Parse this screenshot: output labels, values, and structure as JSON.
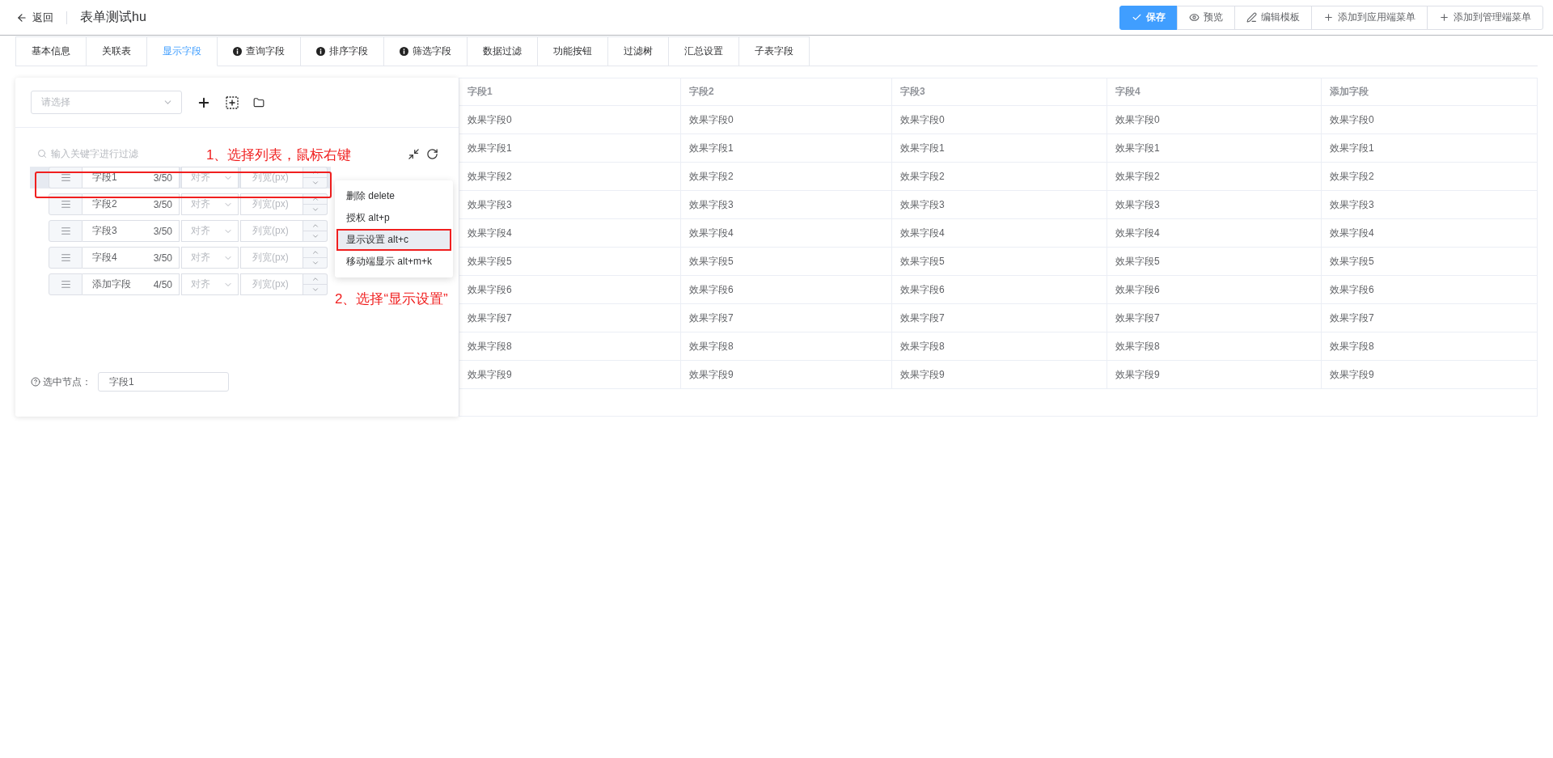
{
  "header": {
    "back_label": "返回",
    "title": "表单测试hu",
    "actions": [
      {
        "label": "保存",
        "kind": "save"
      },
      {
        "label": "预览",
        "kind": "preview"
      },
      {
        "label": "编辑模板",
        "kind": "edit"
      },
      {
        "label": "添加到应用端菜单",
        "kind": "add"
      },
      {
        "label": "添加到管理端菜单",
        "kind": "add"
      }
    ]
  },
  "tabs": [
    {
      "label": "基本信息",
      "selected": false,
      "info_icon": false
    },
    {
      "label": "关联表",
      "selected": false,
      "info_icon": false
    },
    {
      "label": "显示字段",
      "selected": true,
      "info_icon": false
    },
    {
      "label": "查询字段",
      "selected": false,
      "info_icon": true
    },
    {
      "label": "排序字段",
      "selected": false,
      "info_icon": true
    },
    {
      "label": "筛选字段",
      "selected": false,
      "info_icon": true
    },
    {
      "label": "数据过滤",
      "selected": false,
      "info_icon": false
    },
    {
      "label": "功能按钮",
      "selected": false,
      "info_icon": false
    },
    {
      "label": "过滤树",
      "selected": false,
      "info_icon": false
    },
    {
      "label": "汇总设置",
      "selected": false,
      "info_icon": false
    },
    {
      "label": "子表字段",
      "selected": false,
      "info_icon": false
    }
  ],
  "left_panel": {
    "select": {
      "placeholder": "请选择"
    },
    "filter": {
      "placeholder": "输入关键字进行过滤"
    },
    "tree_rows": [
      {
        "name": "字段1",
        "count": "3/50",
        "align_placeholder": "对齐",
        "width_placeholder": "列宽(px)",
        "selected": true
      },
      {
        "name": "字段2",
        "count": "3/50",
        "align_placeholder": "对齐",
        "width_placeholder": "列宽(px)",
        "selected": false
      },
      {
        "name": "字段3",
        "count": "3/50",
        "align_placeholder": "对齐",
        "width_placeholder": "列宽(px)",
        "selected": false
      },
      {
        "name": "字段4",
        "count": "3/50",
        "align_placeholder": "对齐",
        "width_placeholder": "列宽(px)",
        "selected": false
      },
      {
        "name": "添加字段",
        "count": "4/50",
        "align_placeholder": "对齐",
        "width_placeholder": "列宽(px)",
        "selected": false
      }
    ],
    "selected_node": {
      "label": "选中节点：",
      "value": "字段1"
    }
  },
  "context_menu": {
    "items": [
      {
        "label": "删除 delete",
        "selected": false
      },
      {
        "label": "授权 alt+p",
        "selected": false
      },
      {
        "label": "显示设置 alt+c",
        "selected": true
      },
      {
        "label": "移动端显示 alt+m+k",
        "selected": false
      }
    ]
  },
  "callouts": [
    "1、选择列表，鼠标右键",
    "2、选择“显示设置”"
  ],
  "table": {
    "columns": [
      "字段1",
      "字段2",
      "字段3",
      "字段4",
      "添加字段"
    ],
    "rows": [
      [
        "效果字段0",
        "效果字段0",
        "效果字段0",
        "效果字段0",
        "效果字段0"
      ],
      [
        "效果字段1",
        "效果字段1",
        "效果字段1",
        "效果字段1",
        "效果字段1"
      ],
      [
        "效果字段2",
        "效果字段2",
        "效果字段2",
        "效果字段2",
        "效果字段2"
      ],
      [
        "效果字段3",
        "效果字段3",
        "效果字段3",
        "效果字段3",
        "效果字段3"
      ],
      [
        "效果字段4",
        "效果字段4",
        "效果字段4",
        "效果字段4",
        "效果字段4"
      ],
      [
        "效果字段5",
        "效果字段5",
        "效果字段5",
        "效果字段5",
        "效果字段5"
      ],
      [
        "效果字段6",
        "效果字段6",
        "效果字段6",
        "效果字段6",
        "效果字段6"
      ],
      [
        "效果字段7",
        "效果字段7",
        "效果字段7",
        "效果字段7",
        "效果字段7"
      ],
      [
        "效果字段8",
        "效果字段8",
        "效果字段8",
        "效果字段8",
        "效果字段8"
      ],
      [
        "效果字段9",
        "效果字段9",
        "效果字段9",
        "效果字段9",
        "效果字段9"
      ]
    ]
  }
}
